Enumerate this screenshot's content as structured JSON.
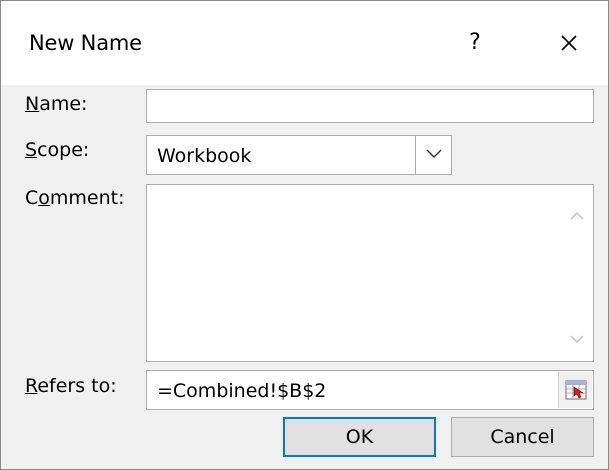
{
  "window": {
    "title": "New Name",
    "help_label": "?"
  },
  "form": {
    "name_label_key": "N",
    "name_label_rest": "ame:",
    "name_value": "",
    "scope_label_key": "S",
    "scope_label_rest": "cope:",
    "scope_value": "Workbook",
    "comment_label_pre": "C",
    "comment_label_key": "o",
    "comment_label_rest": "mment:",
    "comment_value": "",
    "refers_label_key": "R",
    "refers_label_rest": "efers to:",
    "refers_value": "=Combined!$B$2"
  },
  "buttons": {
    "ok": "OK",
    "cancel": "Cancel"
  },
  "icons": {
    "close": "close-icon",
    "dropdown": "chevron-down-icon",
    "scroll_up": "chevron-up-icon",
    "scroll_down": "chevron-down-icon",
    "collapse": "collapse-dialog-icon"
  },
  "colors": {
    "dialog_bg": "#f0f0f0",
    "titlebar_bg": "#ffffff",
    "default_button_border": "#0078d7",
    "button_bg": "#e1e1e1"
  }
}
